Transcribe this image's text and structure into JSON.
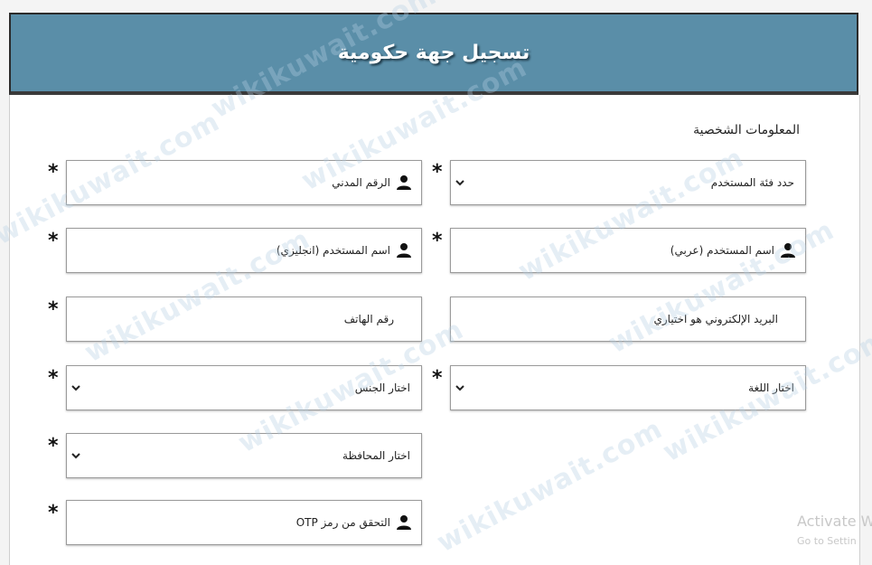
{
  "header": {
    "title": "تسجيل جهة حكومية"
  },
  "section": {
    "title": "المعلومات الشخصية"
  },
  "fields": {
    "user_category": {
      "label": "حدد فئة المستخدم"
    },
    "civil_id": {
      "label": "الرقم المدني"
    },
    "username_ar": {
      "label": "اسم المستخدم (عربي)"
    },
    "username_en": {
      "label": "اسم المستخدم (انجليزي)"
    },
    "email": {
      "label": "البريد الإلكتروني هو اختياري"
    },
    "phone": {
      "label": "رقم الهاتف"
    },
    "language": {
      "label": "اختار اللغة"
    },
    "gender": {
      "label": "اختار الجنس"
    },
    "governorate": {
      "label": "اختار المحافظة"
    },
    "otp": {
      "label": "التحقق من رمز OTP"
    }
  },
  "required_mark": "*",
  "watermark": "wikikuwait.com",
  "os_overlay": {
    "line1": "Activate Wi",
    "line2": "Go to Settin"
  }
}
